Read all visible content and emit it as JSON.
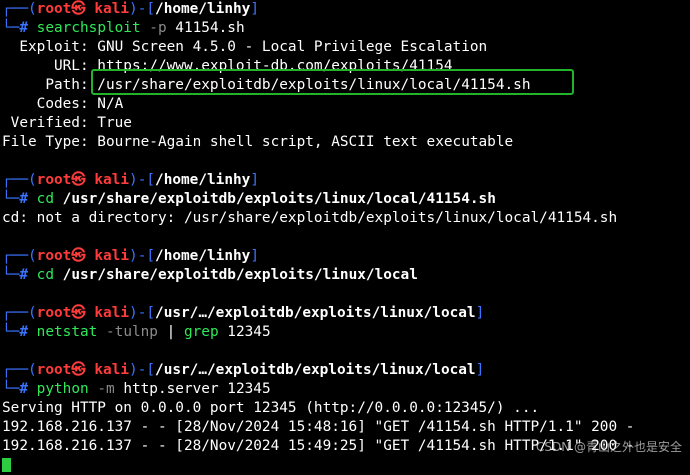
{
  "prompt_sep": "─",
  "prompt_user": "root㉿ kali",
  "prompts": [
    {
      "dir": "/home/linhy",
      "command": "searchsploit",
      "args": [
        {
          "text": " -p",
          "kind": "dim"
        },
        {
          "text": " 41154.sh",
          "kind": "plain"
        }
      ]
    },
    {
      "dir": "/home/linhy",
      "command": "cd",
      "args": [
        {
          "text": " /usr/share/exploitdb/exploits/linux/local/41154.sh",
          "kind": "bold"
        }
      ]
    },
    {
      "dir": "/home/linhy",
      "command": "cd",
      "args": [
        {
          "text": " /usr/share/exploitdb/exploits/linux/local",
          "kind": "bold"
        }
      ]
    },
    {
      "dir": "/usr/…/exploitdb/exploits/linux/local",
      "command": "netstat",
      "args": [
        {
          "text": " -tulnp",
          "kind": "dim"
        },
        {
          "text": " | ",
          "kind": "plain"
        },
        {
          "text": "grep",
          "kind": "cmd"
        },
        {
          "text": " 12345",
          "kind": "plain"
        }
      ]
    },
    {
      "dir": "/usr/…/exploitdb/exploits/linux/local",
      "command": "python",
      "args": [
        {
          "text": " -m",
          "kind": "dim"
        },
        {
          "text": " http.server 12345",
          "kind": "plain"
        }
      ]
    }
  ],
  "searchsploit": {
    "exploit_label": "  Exploit:",
    "exploit_value": " GNU Screen 4.5.0 - Local Privilege Escalation",
    "url_label": "      URL:",
    "url_value": " https://www.exploit-db.com/exploits/41154",
    "path_label": "     Path:",
    "path_value": " /usr/share/exploitdb/exploits/linux/local/41154.sh",
    "codes_label": "    Codes:",
    "codes_value": " N/A",
    "verified_label": " Verified:",
    "verified_value": " True",
    "filetype_label": "File Type:",
    "filetype_value": " Bourne-Again shell script, ASCII text executable"
  },
  "cd_error": "cd: not a directory: /usr/share/exploitdb/exploits/linux/local/41154.sh",
  "server_output": [
    "Serving HTTP on 0.0.0.0 port 12345 (http://0.0.0.0:12345/) ...",
    "192.168.216.137 - - [28/Nov/2024 15:48:16] \"GET /41154.sh HTTP/1.1\" 200 -",
    "192.168.216.137 - - [28/Nov/2024 15:49:25] \"GET /41154.sh HTTP/1.1\" 200 -"
  ],
  "watermark": "CSDN @青山之外也是安全",
  "colors": {
    "prompt_frame": "#3a74ff",
    "prompt_user": "#ff3b3b",
    "command": "#2ee85a",
    "highlight_box": "#22b32a"
  }
}
